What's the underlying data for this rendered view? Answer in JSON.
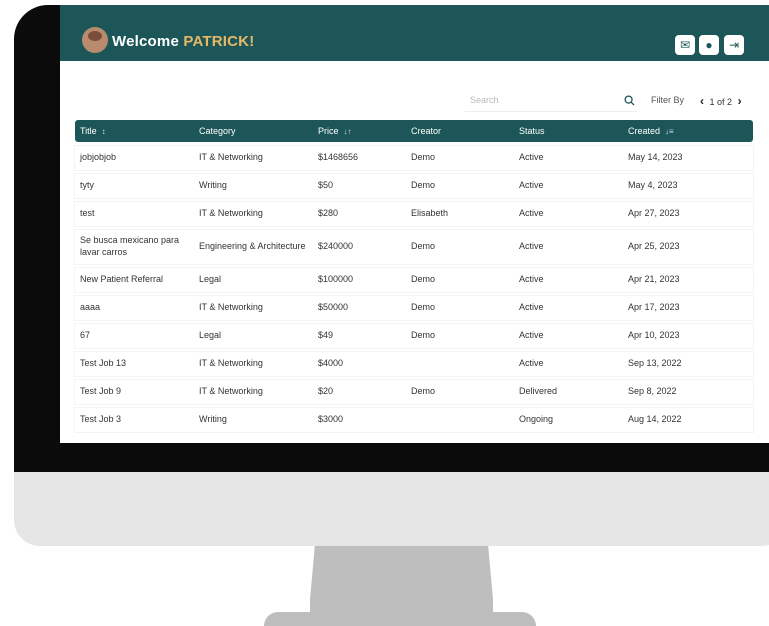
{
  "header": {
    "welcome_prefix": "Welcome",
    "welcome_name": "PATRICK!",
    "icons": [
      "message-icon",
      "bell-icon",
      "logout-icon"
    ]
  },
  "toolbar": {
    "search_placeholder": "Search",
    "filter_label": "Filter By",
    "pagination": "1 of 2"
  },
  "table": {
    "columns": [
      "Title",
      "Category",
      "Price",
      "Creator",
      "Status",
      "Created"
    ],
    "rows": [
      {
        "title": "jobjobjob",
        "category": "IT & Networking",
        "price": "$1468656",
        "creator": "Demo",
        "status": "Active",
        "created": "May 14, 2023"
      },
      {
        "title": "tyty",
        "category": "Writing",
        "price": "$50",
        "creator": "Demo",
        "status": "Active",
        "created": "May 4, 2023"
      },
      {
        "title": "test",
        "category": "IT & Networking",
        "price": "$280",
        "creator": "Elisabeth",
        "status": "Active",
        "created": "Apr 27, 2023"
      },
      {
        "title": "Se busca mexicano para lavar carros",
        "category": "Engineering & Architecture",
        "price": "$240000",
        "creator": "Demo",
        "status": "Active",
        "created": "Apr 25, 2023"
      },
      {
        "title": "New Patient Referral",
        "category": "Legal",
        "price": "$100000",
        "creator": "Demo",
        "status": "Active",
        "created": "Apr 21, 2023"
      },
      {
        "title": "aaaa",
        "category": "IT & Networking",
        "price": "$50000",
        "creator": "Demo",
        "status": "Active",
        "created": "Apr 17, 2023"
      },
      {
        "title": "67",
        "category": "Legal",
        "price": "$49",
        "creator": "Demo",
        "status": "Active",
        "created": "Apr 10, 2023"
      },
      {
        "title": "Test Job 13",
        "category": "IT & Networking",
        "price": "$4000",
        "creator": "",
        "status": "Active",
        "created": "Sep 13, 2022"
      },
      {
        "title": "Test Job 9",
        "category": "IT & Networking",
        "price": "$20",
        "creator": "Demo",
        "status": "Delivered",
        "created": "Sep 8, 2022"
      },
      {
        "title": "Test Job 3",
        "category": "Writing",
        "price": "$3000",
        "creator": "",
        "status": "Ongoing",
        "created": "Aug 14, 2022"
      }
    ]
  },
  "colors": {
    "brand": "#1d5658",
    "accent": "#e9b866"
  }
}
